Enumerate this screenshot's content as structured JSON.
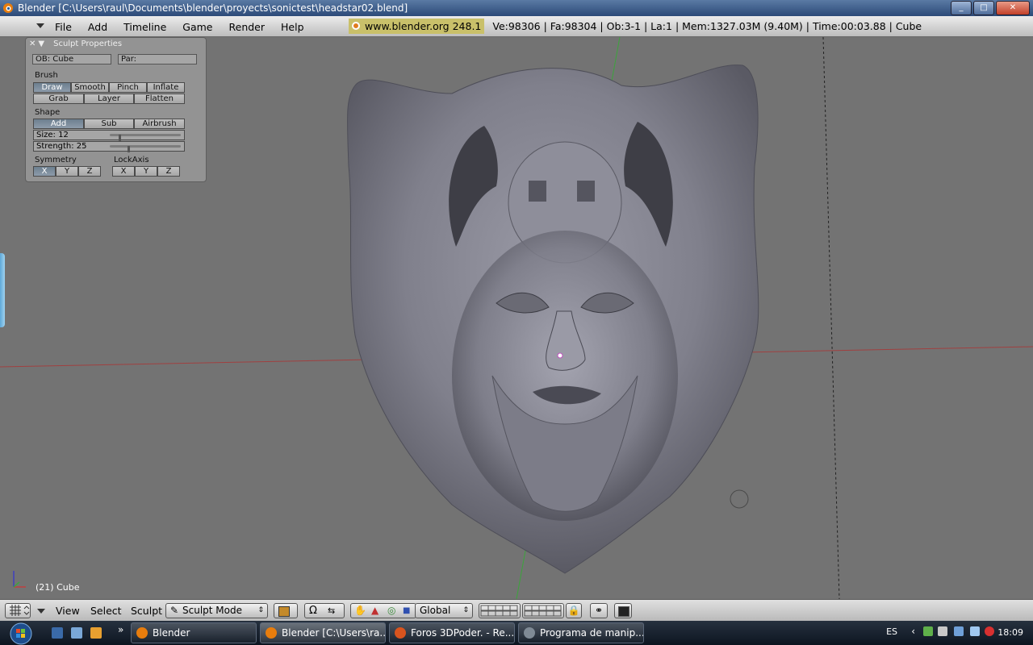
{
  "window": {
    "title": "Blender [C:\\Users\\raul\\Documents\\blender\\proyects\\sonictest\\headstar02.blend]",
    "controls": {
      "minimize": "_",
      "maximize": "□",
      "close": "✕"
    }
  },
  "menubar": {
    "items": [
      "File",
      "Add",
      "Timeline",
      "Game",
      "Render",
      "Help"
    ],
    "website": "www.blender.org 248.1",
    "stats": "Ve:98306 | Fa:98304 | Ob:3-1 | La:1  | Mem:1327.03M (9.40M)  | Time:00:03.88 | Cube"
  },
  "sculpt_panel": {
    "title": "Sculpt Properties",
    "close_icon": "✕",
    "collapse_icon": "▼",
    "ob_field": "OB: Cube",
    "par_field": "Par:",
    "brush_label": "Brush",
    "brush_row1": [
      "Draw",
      "Smooth",
      "Pinch",
      "Inflate"
    ],
    "brush_row2": [
      "Grab",
      "Layer",
      "Flatten"
    ],
    "brush_selected": "Draw",
    "shape_label": "Shape",
    "shape_buttons": [
      "Add",
      "Sub",
      "Airbrush"
    ],
    "shape_selected": "Add",
    "size": {
      "text": "Size: 12",
      "value": 12,
      "max": 100
    },
    "strength": {
      "text": "Strength: 25",
      "value": 25,
      "max": 100
    },
    "symmetry_label": "Symmetry",
    "symmetry_buttons": [
      "X",
      "Y",
      "Z"
    ],
    "symmetry_selected": "X",
    "lockaxis_label": "LockAxis",
    "lockaxis_buttons": [
      "X",
      "Y",
      "Z"
    ]
  },
  "viewport": {
    "object_label": "(21) Cube"
  },
  "bottom_header": {
    "menus": [
      "View",
      "Select",
      "Sculpt"
    ],
    "mode": "Sculpt Mode",
    "orientation": "Global"
  },
  "taskbar": {
    "tasks": [
      {
        "label": "Blender",
        "icon_color": "#e87d0d"
      },
      {
        "label": "Blender [C:\\Users\\ra...",
        "icon_color": "#e87d0d"
      },
      {
        "label": "Foros 3DPoder. - Re...",
        "icon_color": "#d9541e"
      },
      {
        "label": "Programa de manip...",
        "icon_color": "#7f8a95"
      }
    ],
    "language": "ES",
    "clock": "18:09"
  }
}
